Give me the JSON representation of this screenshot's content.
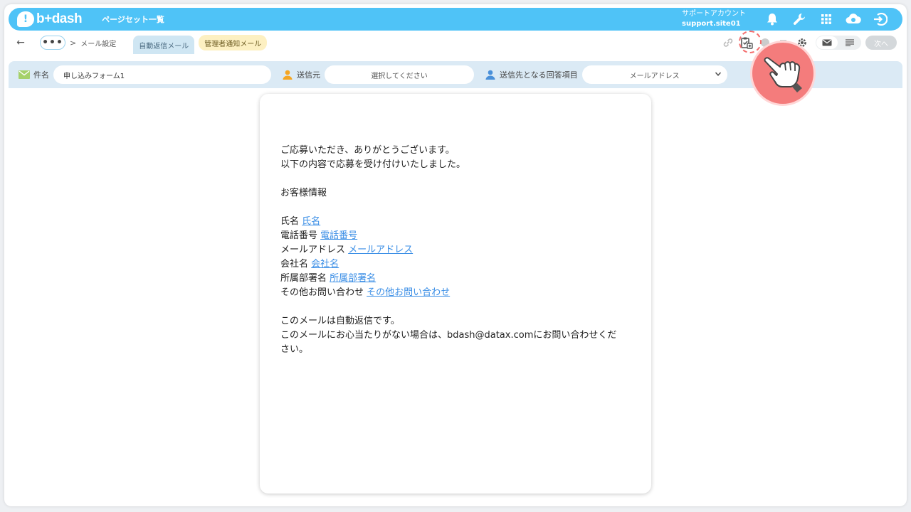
{
  "app": {
    "logo_text": "b+dash",
    "logo_mark": "!",
    "page_title": "ページセット一覧"
  },
  "account": {
    "label": "サポートアカウント",
    "id": "support.site01"
  },
  "top_icons": [
    "bell-icon",
    "wrench-icon",
    "grid-icon",
    "cloud-badge-icon",
    "logout-icon"
  ],
  "nav": {
    "back": "←",
    "more": "•••",
    "separator": ">",
    "breadcrumb": "メール設定",
    "tabs": [
      {
        "label": "自動返信メール",
        "active": true
      },
      {
        "label": "管理者通知メール",
        "active": false
      }
    ],
    "next_label": "次へ"
  },
  "settings": {
    "subject_label": "件名",
    "subject_value": "申し込みフォーム1",
    "from_label": "送信元",
    "from_placeholder": "選択してください",
    "to_label": "送信先となる回答項目",
    "to_value": "メールアドレス"
  },
  "email_body": {
    "greeting_1": "ご応募いただき、ありがとうございます。",
    "greeting_2": "以下の内容で応募を受け付けいたしました。",
    "section_title": "お客様情報",
    "fields": [
      {
        "label": "氏名",
        "tag": "氏名"
      },
      {
        "label": "電話番号",
        "tag": "電話番号"
      },
      {
        "label": "メールアドレス",
        "tag": "メールアドレス"
      },
      {
        "label": "会社名",
        "tag": "会社名"
      },
      {
        "label": "所属部署名",
        "tag": "所属部署名"
      },
      {
        "label": "その他お問い合わせ",
        "tag": "その他お問い合わせ"
      }
    ],
    "footer_1": "このメールは自動返信です。",
    "footer_2a": "このメールにお心当たりがない場合は、bdash@datax.comにお問い合わせくだ",
    "footer_2b": "さい。"
  },
  "colors": {
    "header": "#4fc3f7",
    "settings_bar": "#dbeaf5",
    "link": "#3a8ee6",
    "annotation": "#f47c7c"
  }
}
